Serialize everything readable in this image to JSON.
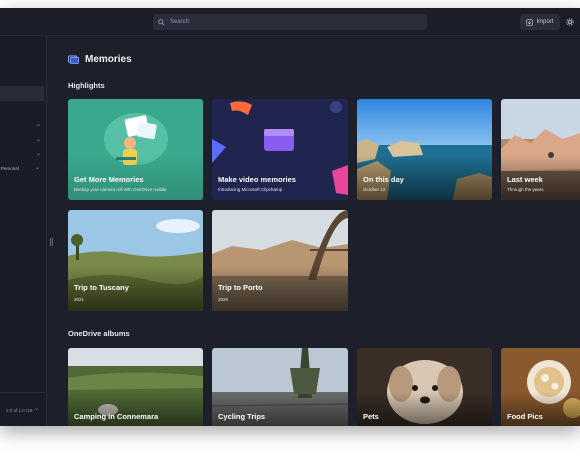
{
  "search": {
    "placeholder": "Search"
  },
  "toolbar": {
    "import_label": "Import"
  },
  "sidebar": {
    "items": [
      {
        "label": "Personal"
      }
    ],
    "storage": {
      "label": "0.0 of 1.0 GB"
    }
  },
  "page": {
    "title": "Memories"
  },
  "highlights": {
    "title": "Highlights",
    "cards": [
      {
        "title": "Get More Memories",
        "subtitle": "Backup your camera roll with OneDrive mobile"
      },
      {
        "title": "Make video memories",
        "subtitle": "Introducing Microsoft Clipchamp"
      },
      {
        "title": "On this day",
        "subtitle": "October 12"
      },
      {
        "title": "Last week",
        "subtitle": "Through the years"
      },
      {
        "title": "Trip to Tuscany",
        "subtitle": "2021"
      },
      {
        "title": "Trip to Porto",
        "subtitle": "2020"
      }
    ]
  },
  "albums": {
    "title": "OneDrive albums",
    "cards": [
      {
        "title": "Camping in Connemara"
      },
      {
        "title": "Cycling Trips"
      },
      {
        "title": "Pets"
      },
      {
        "title": "Food Pics"
      }
    ]
  },
  "colors": {
    "window_bg": "#1d1f2b",
    "sidebar_bg": "#1a1c27",
    "teal_card": "#3aa88e",
    "navy_card": "#202550",
    "accent_purple": "#8a5cf0",
    "accent_pink": "#e8469a"
  },
  "icons": [
    "search-icon",
    "import-icon",
    "settings-icon",
    "memories-icon",
    "chevron-down-icon",
    "collapse-handle-icon"
  ]
}
